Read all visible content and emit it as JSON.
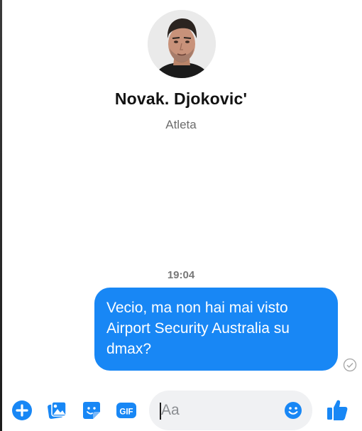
{
  "conversation": {
    "contact_name": "Novak. Djokovic'",
    "contact_subtitle": "Atleta"
  },
  "thread": {
    "timestamp": "19:04",
    "messages": [
      {
        "sender": "me",
        "lines": [
          "Vecio, ma non hai mai visto",
          "Airport Security Australia su",
          "dmax?"
        ],
        "status": "sent"
      }
    ]
  },
  "composer": {
    "placeholder": "Aa",
    "tools": [
      "plus-icon",
      "photo-icon",
      "sticker-icon",
      "gif-icon"
    ],
    "gif_label": "GIF",
    "emoji": "emoji-icon",
    "send": "thumbs-up-icon"
  },
  "colors": {
    "accent": "#1887f5",
    "bubble_text": "#ffffff",
    "subtitle": "#6d6d6d",
    "input_bg": "#f0f1f3"
  }
}
